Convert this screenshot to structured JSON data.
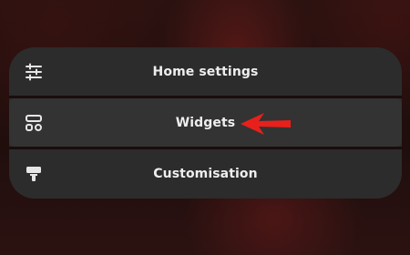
{
  "menu": {
    "items": [
      {
        "label": "Home settings",
        "icon": "sliders-icon"
      },
      {
        "label": "Widgets",
        "icon": "widgets-icon"
      },
      {
        "label": "Customisation",
        "icon": "paint-roller-icon"
      }
    ]
  },
  "annotation": {
    "icon": "red-arrow-icon",
    "color": "#e8201c"
  },
  "colors": {
    "panel": "#2c2c2c",
    "text": "#eeeeee",
    "icon": "#e6e6e6"
  }
}
